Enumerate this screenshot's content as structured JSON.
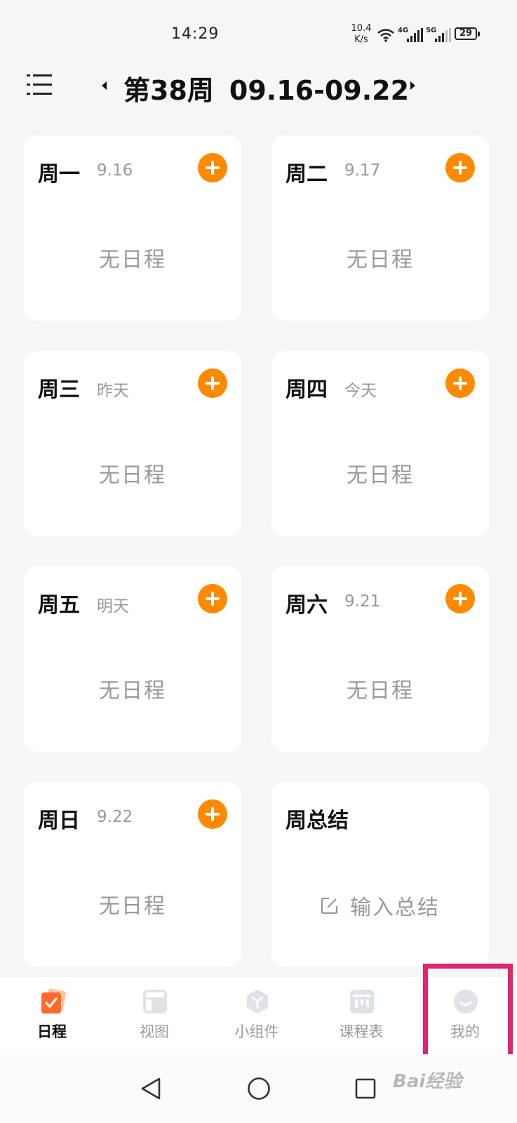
{
  "status_bar": {
    "time": "14:29",
    "net_speed_value": "10.4",
    "net_speed_unit": "K/s",
    "sim1_label": "4G",
    "sim2_label": "5G",
    "battery": "29"
  },
  "header": {
    "week_label": "第38周",
    "date_range": "09.16-09.22"
  },
  "days": [
    {
      "day": "周一",
      "date": "9.16",
      "content": "无日程"
    },
    {
      "day": "周二",
      "date": "9.17",
      "content": "无日程"
    },
    {
      "day": "周三",
      "date": "昨天",
      "content": "无日程"
    },
    {
      "day": "周四",
      "date": "今天",
      "content": "无日程"
    },
    {
      "day": "周五",
      "date": "明天",
      "content": "无日程"
    },
    {
      "day": "周六",
      "date": "9.21",
      "content": "无日程"
    },
    {
      "day": "周日",
      "date": "9.22",
      "content": "无日程"
    }
  ],
  "summary": {
    "title": "周总结",
    "placeholder": "输入总结"
  },
  "bottom_nav": [
    {
      "label": "日程",
      "icon": "schedule-check-icon"
    },
    {
      "label": "视图",
      "icon": "layout-view-icon"
    },
    {
      "label": "小组件",
      "icon": "widget-cube-icon"
    },
    {
      "label": "课程表",
      "icon": "timetable-icon"
    },
    {
      "label": "我的",
      "icon": "profile-smile-icon"
    }
  ],
  "colors": {
    "accent": "#ff8a00",
    "highlight": "#e1256e",
    "muted_text": "#999999"
  },
  "watermark": "Bai经验"
}
